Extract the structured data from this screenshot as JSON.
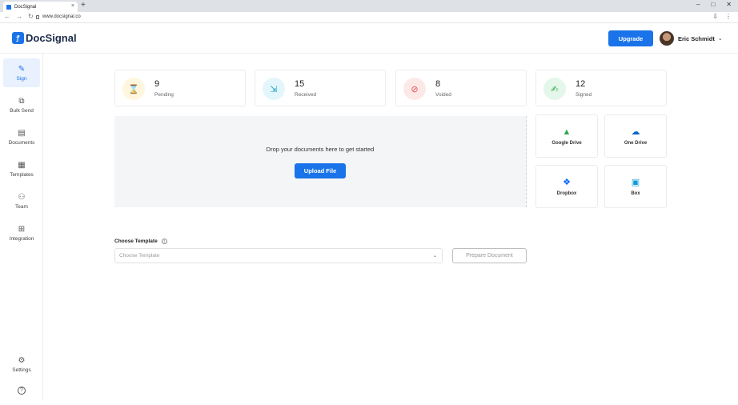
{
  "browser": {
    "tab_title": "DocSignal",
    "url": "www.docsignal.co",
    "new_tab": "+",
    "close_tab": "×",
    "minimize": "–",
    "maximize": "□",
    "close_window": "✕"
  },
  "header": {
    "logo_text": "DocSignal",
    "upgrade_label": "Upgrade",
    "user_name": "Eric Schmidt"
  },
  "sidebar": {
    "items": [
      {
        "label": "Sign",
        "icon": "pen-icon",
        "glyph": "✎",
        "active": true
      },
      {
        "label": "Bulk Send",
        "icon": "stack-icon",
        "glyph": "⧉"
      },
      {
        "label": "Documents",
        "icon": "document-icon",
        "glyph": "▤"
      },
      {
        "label": "Templates",
        "icon": "template-icon",
        "glyph": "▦"
      },
      {
        "label": "Team",
        "icon": "team-icon",
        "glyph": "⚇"
      },
      {
        "label": "Integration",
        "icon": "integration-icon",
        "glyph": "⊞"
      }
    ],
    "settings_label": "Settings",
    "help_glyph": "?"
  },
  "stats": [
    {
      "value": "9",
      "label": "Pending",
      "icon": "pending-icon",
      "glyph": "⌛",
      "color": "#f5a623",
      "bg": "#fff6dd"
    },
    {
      "value": "15",
      "label": "Received",
      "icon": "received-icon",
      "glyph": "⇲",
      "color": "#17a2c4",
      "bg": "#e3f6fb"
    },
    {
      "value": "8",
      "label": "Voided",
      "icon": "voided-icon",
      "glyph": "⊘",
      "color": "#e34b4b",
      "bg": "#fde8e8"
    },
    {
      "value": "12",
      "label": "Signed",
      "icon": "signed-icon",
      "glyph": "✍",
      "color": "#28a745",
      "bg": "#e4f7ea"
    }
  ],
  "upload": {
    "prompt": "Drop your documents here to get started",
    "button_label": "Upload File"
  },
  "storage": [
    {
      "label": "Google Drive",
      "icon": "google-drive-icon",
      "glyph": "▲",
      "color": "#34a853"
    },
    {
      "label": "One Drive",
      "icon": "onedrive-icon",
      "glyph": "☁",
      "color": "#0a66c2"
    },
    {
      "label": "Dropbox",
      "icon": "dropbox-icon",
      "glyph": "❖",
      "color": "#0061fe"
    },
    {
      "label": "Box",
      "icon": "box-icon",
      "glyph": "▣",
      "color": "#0f9bd7"
    }
  ],
  "template": {
    "label": "Choose Template",
    "placeholder": "Choose Template",
    "prepare_label": "Prepare Document"
  },
  "colors": {
    "accent": "#1a73e8",
    "brand_text": "#1b2a49"
  }
}
